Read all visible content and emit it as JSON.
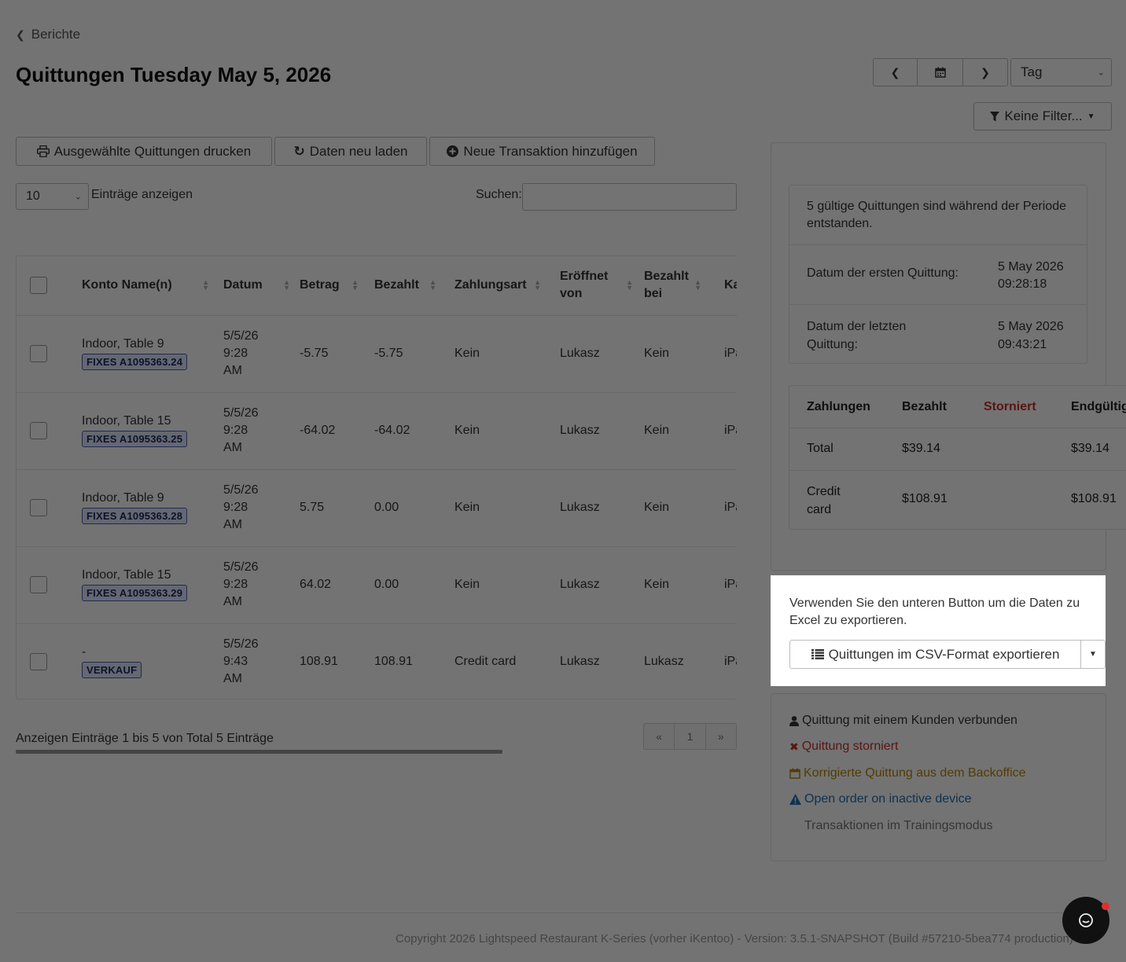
{
  "breadcrumb": {
    "label": "Berichte"
  },
  "page": {
    "title": "Quittungen Tuesday May 5, 2026"
  },
  "date_nav": {
    "period": "Tag"
  },
  "filters": {
    "label": "Keine Filter..."
  },
  "actions": {
    "print": "Ausgewählte Quittungen drucken",
    "reload": "Daten neu laden",
    "add": "Neue Transaktion hinzufügen"
  },
  "table_controls": {
    "page_size": "10",
    "page_size_label": "Einträge anzeigen",
    "search_label": "Suchen:",
    "search_value": ""
  },
  "table": {
    "headers": [
      "Konto Name(n)",
      "Datum",
      "Betrag",
      "Bezahlt",
      "Zahlungsart",
      "Eröffnet von",
      "Bezahlt bei",
      "Ka"
    ],
    "rows": [
      {
        "account": "Indoor, Table 9",
        "badge": "FIXES A1095363.24",
        "date": "5/5/26",
        "time": "9:28",
        "ampm": "AM",
        "amount": "-5.75",
        "paid": "-5.75",
        "method": "Kein",
        "opened_by": "Lukasz",
        "paid_at": "Kein",
        "ka": "iPa"
      },
      {
        "account": "Indoor, Table 15",
        "badge": "FIXES A1095363.25",
        "date": "5/5/26",
        "time": "9:28",
        "ampm": "AM",
        "amount": "-64.02",
        "paid": "-64.02",
        "method": "Kein",
        "opened_by": "Lukasz",
        "paid_at": "Kein",
        "ka": "iPa"
      },
      {
        "account": "Indoor, Table 9",
        "badge": "FIXES A1095363.28",
        "date": "5/5/26",
        "time": "9:28",
        "ampm": "AM",
        "amount": "5.75",
        "paid": "0.00",
        "method": "Kein",
        "opened_by": "Lukasz",
        "paid_at": "Kein",
        "ka": "iPa"
      },
      {
        "account": "Indoor, Table 15",
        "badge": "FIXES A1095363.29",
        "date": "5/5/26",
        "time": "9:28",
        "ampm": "AM",
        "amount": "64.02",
        "paid": "0.00",
        "method": "Kein",
        "opened_by": "Lukasz",
        "paid_at": "Kein",
        "ka": "iPa"
      },
      {
        "account": "-",
        "badge": "VERKAUF",
        "date": "5/5/26",
        "time": "9:43",
        "ampm": "AM",
        "amount": "108.91",
        "paid": "108.91",
        "method": "Credit card",
        "opened_by": "Lukasz",
        "paid_at": "Lukasz",
        "ka": "iPa"
      }
    ],
    "summary": "Anzeigen Einträge 1 bis 5 von Total 5 Einträge",
    "pager": {
      "prev": "«",
      "page": "1",
      "next": "»"
    }
  },
  "summary_panel": {
    "valid_text": "5 gültige Quittungen sind während der Periode entstanden.",
    "first_label": "Datum der ersten Quittung:",
    "first_date": "5 May 2026",
    "first_time": "09:28:18",
    "last_label": "Datum der letzten Quittung:",
    "last_date": "5 May 2026",
    "last_time": "09:43:21",
    "payments": {
      "headers": [
        "Zahlungen",
        "Bezahlt",
        "Storniert",
        "Endgültig"
      ],
      "rows": [
        {
          "name": "Total",
          "paid": "$39.14",
          "cancelled": "",
          "final": "$39.14"
        },
        {
          "name": "Credit card",
          "paid": "$108.91",
          "cancelled": "",
          "final": "$108.91"
        }
      ]
    }
  },
  "export": {
    "text": "Verwenden Sie den unteren Button um die Daten zu Excel zu exportieren.",
    "button": "Quittungen im CSV-Format exportieren"
  },
  "legend": {
    "customer": "Quittung mit einem Kunden verbunden",
    "cancelled": "Quittung storniert",
    "corrected": "Korrigierte Quittung aus dem Backoffice",
    "inactive": "Open order on inactive device",
    "training": "Transaktionen im Trainingsmodus"
  },
  "footer": {
    "copyright": "Copyright 2026 Lightspeed Restaurant K-Series (vorher iKentoo) - Version: 3.5.1-SNAPSHOT (Build #57210-5bea774 production)"
  },
  "colors": {
    "danger": "#c9302c",
    "warning": "#b8860b",
    "info": "#1f6fb2",
    "badge_border": "#4a5bb3"
  }
}
